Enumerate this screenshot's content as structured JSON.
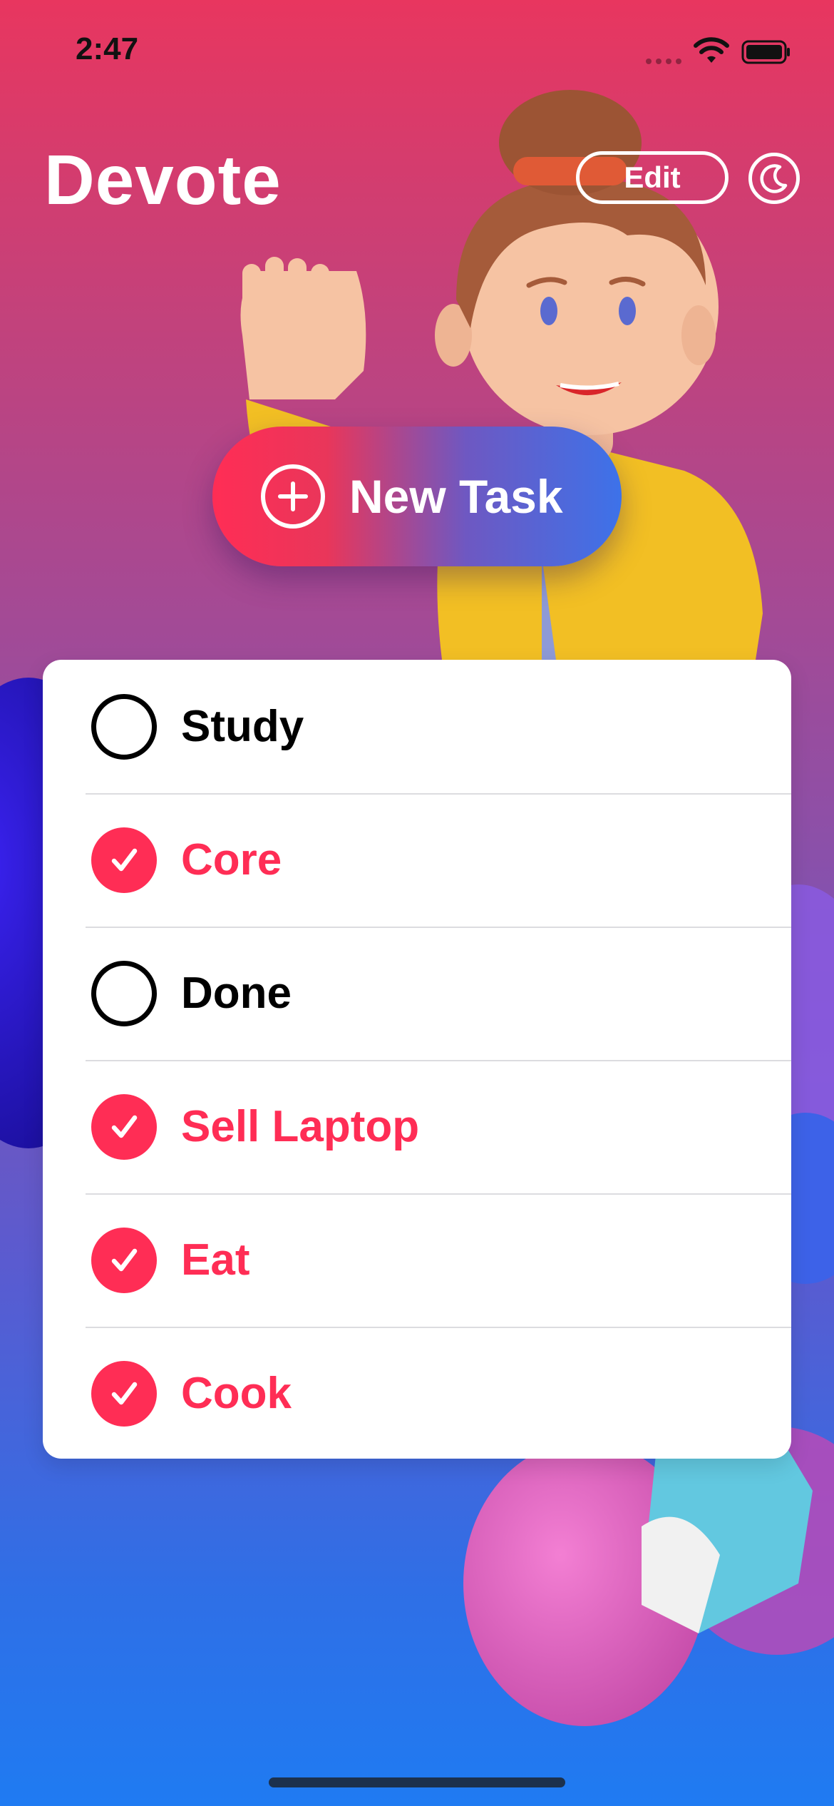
{
  "status_bar": {
    "time": "2:47"
  },
  "header": {
    "title": "Devote",
    "edit_label": "Edit"
  },
  "new_task": {
    "label": "New Task"
  },
  "tasks": [
    {
      "label": "Study",
      "completed": false
    },
    {
      "label": "Core",
      "completed": true
    },
    {
      "label": "Done",
      "completed": false
    },
    {
      "label": "Sell Laptop",
      "completed": true
    },
    {
      "label": "Eat",
      "completed": true
    },
    {
      "label": "Cook",
      "completed": true
    }
  ],
  "colors": {
    "accent": "#ff2d55",
    "background_top": "#e8365f",
    "background_bottom": "#1f7bf2"
  }
}
